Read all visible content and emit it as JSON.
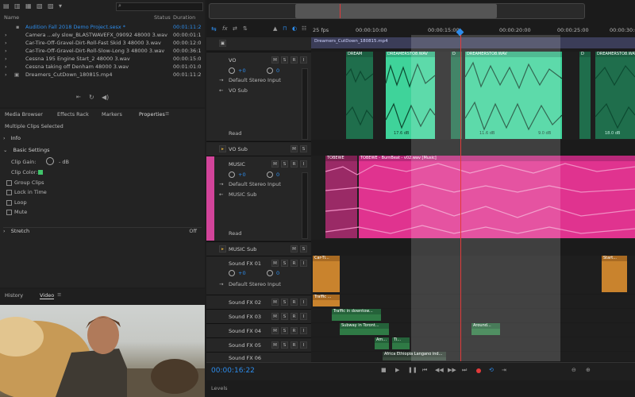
{
  "files_panel": {
    "col_name": "Name",
    "col_status": "Status",
    "col_duration": "Duration",
    "files": [
      {
        "name": "Audition Fall 2018 Demo Project.sesx *",
        "duration": "00:01:11:2"
      },
      {
        "name": "Camera ...ely slow_BLASTWAVEFX_09092 48000 3.wav",
        "duration": "00:00:01:1"
      },
      {
        "name": "Car-Tire-Off-Gravel-Dirt-Roll-Fast Skid 3 48000 3.wav",
        "duration": "00:00:12:0"
      },
      {
        "name": "Car-Tire-Off-Gravel-Dirt-Roll-Slow-Long 3 48000 3.wav",
        "duration": "00:00:36:1"
      },
      {
        "name": "Cessna 195 Engine Start_2 48000 3.wav",
        "duration": "00:00:15:0"
      },
      {
        "name": "Cessna taking off Denham 48000 3.wav",
        "duration": "00:01:01:0"
      },
      {
        "name": "Dreamers_CutDown_180815.mp4",
        "duration": "00:01:11:2"
      }
    ]
  },
  "properties_panel": {
    "tabs": [
      "Media Browser",
      "Effects Rack",
      "Markers",
      "Properties"
    ],
    "active_tab": "Properties",
    "subtitle": "Multiple Clips Selected",
    "info_label": "Info",
    "basic_settings_label": "Basic Settings",
    "clip_gain_label": "Clip Gain:",
    "clip_gain_value": "- dB",
    "clip_color_label": "Clip Color:",
    "clip_color": "#41c46b",
    "checkboxes": [
      "Group Clips",
      "Lock in Time",
      "Loop",
      "Mute"
    ],
    "stretch_label": "Stretch",
    "stretch_value": "Off"
  },
  "video_panel": {
    "tabs": [
      "History",
      "Video"
    ],
    "active_tab": "Video"
  },
  "timeline": {
    "fps": "25 fps",
    "timecodes": [
      "00:00:10:00",
      "00:00:15:00",
      "00:00:20:00",
      "00:00:25:00",
      "00:00:30:00"
    ],
    "video_track_clip": "Dreamers_CutDown_180815.mp4",
    "current_time": "00:00:16:22",
    "levels_label": "Levels"
  },
  "tracks": {
    "vo": {
      "name": "VO",
      "volume": "+0",
      "pan": "0",
      "input": "Default Stereo Input",
      "output": "VO Sub",
      "mode": "Read"
    },
    "vo_sub": {
      "name": "VO Sub"
    },
    "music": {
      "name": "MUSIC",
      "volume": "+0",
      "pan": "0",
      "input": "Default Stereo Input",
      "output": "MUSIC Sub",
      "mode": "Read"
    },
    "music_sub": {
      "name": "MUSIC Sub"
    },
    "sfx01": {
      "name": "Sound FX 01",
      "volume": "+0",
      "pan": "0",
      "input": "Default Stereo Input"
    },
    "sfx02": {
      "name": "Sound FX 02"
    },
    "sfx03": {
      "name": "Sound FX 03"
    },
    "sfx04": {
      "name": "Sound FX 04"
    },
    "sfx05": {
      "name": "Sound FX 05"
    },
    "sfx06": {
      "name": "Sound FX 06"
    }
  },
  "track_buttons": {
    "mute": "M",
    "solo": "S",
    "record": "R",
    "input_monitor": "I"
  },
  "clips": {
    "vo_a": "DREAM",
    "vo_b": "DREAMERSTO8.WAV",
    "vo_c": "D",
    "vo_d": "DREAMERSTO8.WAV",
    "vo_e": "D",
    "vo_f": "DREAMERSTO8.WAV",
    "vo_gain_b": "17.6 dB",
    "vo_gain_d": "11.6 dB",
    "vo_gain_d2": "9.0 dB",
    "vo_gain_f": "18.0 dB",
    "music_a": "TOBEWE",
    "music_b": "TOBEWE - BurnBeat - v02.wav [Music]",
    "sfx01_a": "Car-Ti...",
    "sfx01_b": "Start...",
    "sfx02_a": "Traffic ...",
    "sfx03_a": "Traffic in downtow...",
    "sfx04_a": "Subway in Toront...",
    "sfx04_b": "Around...",
    "sfx05_a": "Am...",
    "sfx05_b": "Ti...",
    "sfx06_a": "Africa Ethiopia Langano ind..."
  },
  "colors": {
    "vo_clip": "#3fd39a",
    "vo_clip_dark": "#1f6e4c",
    "music_clip": "#e0338f",
    "music_track": "#d2449a",
    "sfx_clip": "#c9832d",
    "sfx_green": "#2f7a45",
    "accent_blue": "#2d8ceb",
    "playhead": "#e23a3a"
  }
}
